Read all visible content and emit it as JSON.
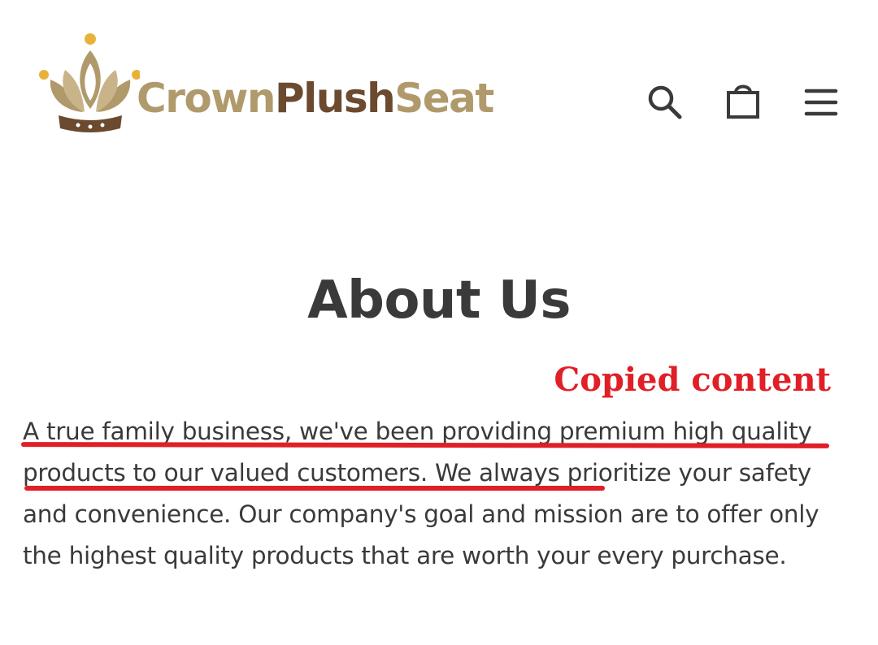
{
  "header": {
    "logo": {
      "text_part1": "Crown",
      "text_part2": "Plush",
      "text_part3": "Seat",
      "icon": "crown-logo-icon"
    },
    "icons": {
      "search": "search-icon",
      "cart": "shopping-bag-icon",
      "menu": "hamburger-menu-icon"
    }
  },
  "main": {
    "title": "About Us",
    "body": "A true family business, we've been providing premium high quality products to our valued customers. We always prioritize your safety and convenience. Our company's goal and mission are to offer only the highest quality products that are worth your every purchase."
  },
  "annotation": {
    "label": "Copied content",
    "color": "#e01f26"
  },
  "colors": {
    "logo_gold": "#b09a6c",
    "logo_brown": "#6b4a2f",
    "text": "#3a3a3a"
  }
}
